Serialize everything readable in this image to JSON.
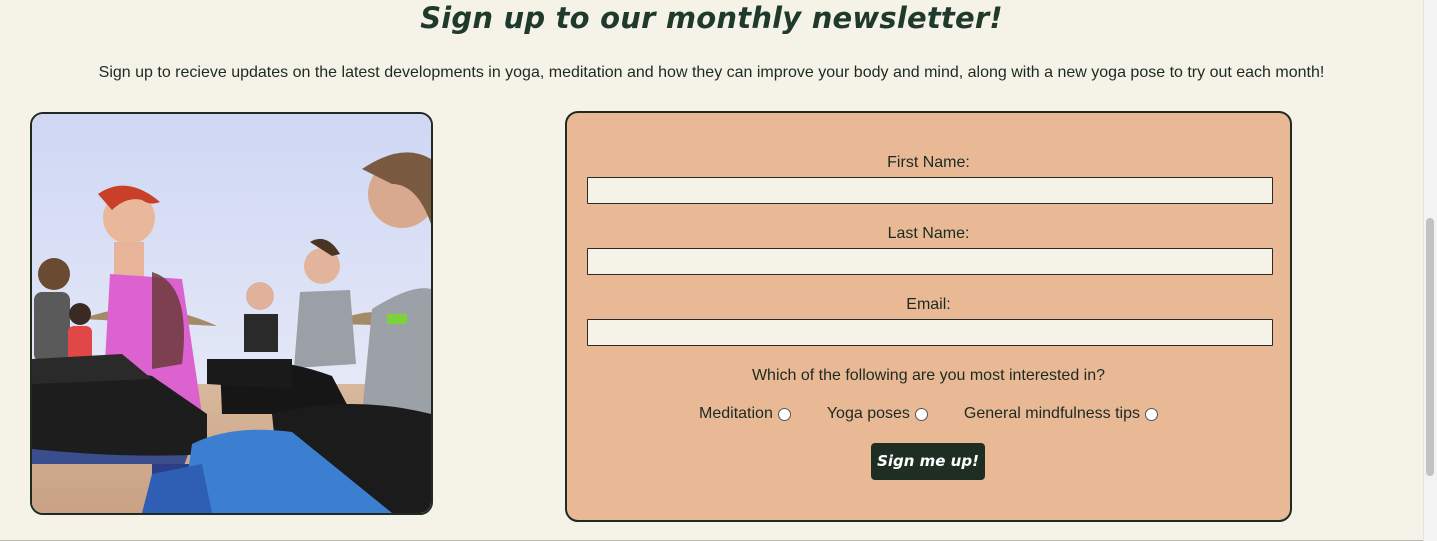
{
  "newsletter": {
    "title": "Sign up to our monthly newsletter!",
    "description": "Sign up to recieve updates on the latest developments in yoga, meditation and how they can improve your body and mind, along with a new yoga pose to try out each month!"
  },
  "form": {
    "first_name_label": "First Name:",
    "first_name_value": "",
    "last_name_label": "Last Name:",
    "last_name_value": "",
    "email_label": "Email:",
    "email_value": "",
    "interest_question": "Which of the following are you most interested in?",
    "options": [
      "Meditation",
      "Yoga poses",
      "General mindfulness tips"
    ],
    "submit_label": "Sign me up!"
  },
  "colors": {
    "background": "#f5f3e8",
    "form_background": "#e9b996",
    "accent_dark": "#1f2e23",
    "title": "#1f3a2a"
  }
}
